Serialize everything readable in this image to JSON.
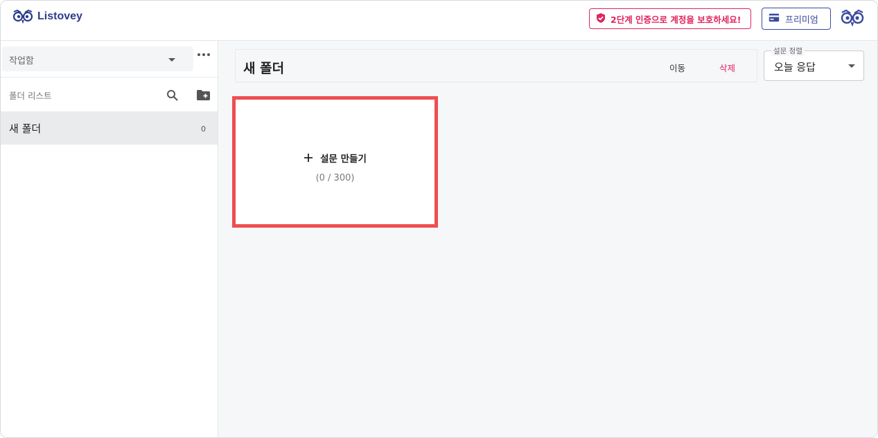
{
  "app": {
    "logo_text": "Listovey"
  },
  "header": {
    "twofa_text": "2단계 인증으로 계정을 보호하세요!",
    "premium_label": "프리미엄",
    "accent_color": "#3a4aa0",
    "alert_color": "#e0245e"
  },
  "sidebar": {
    "workspace_label": "작업함",
    "folder_list_label": "폴더 리스트",
    "folders": [
      {
        "name": "새 폴더",
        "count": "0"
      }
    ]
  },
  "main": {
    "folder_title": "새 폴더",
    "move_label": "이동",
    "delete_label": "삭제",
    "sort": {
      "legend": "설문 정렬",
      "value": "오늘 응답"
    },
    "create_card": {
      "label": "설문 만들기",
      "count": "(0 / 300)",
      "highlight_color": "#ef4e50"
    }
  },
  "icons": [
    "owl-logo-icon",
    "shield-check-icon",
    "card-icon",
    "owl-avatar-icon",
    "chevron-down-icon",
    "more-horizontal-icon",
    "search-icon",
    "folder-plus-icon",
    "plus-icon"
  ]
}
